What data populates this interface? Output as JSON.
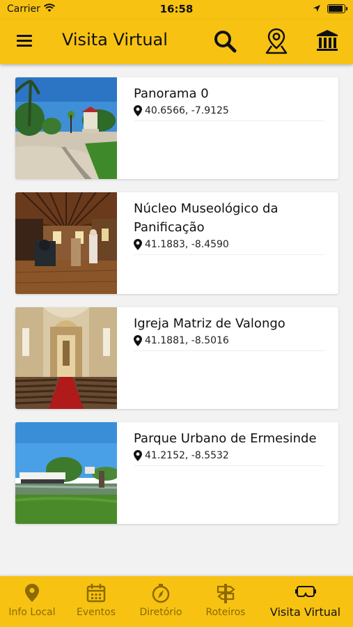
{
  "status": {
    "carrier": "Carrier",
    "time": "16:58"
  },
  "header": {
    "title": "Visita Virtual"
  },
  "items": [
    {
      "title": "Panorama 0",
      "coords": "40.6566, -7.9125"
    },
    {
      "title": "Núcleo Museológico da Panificação",
      "coords": "41.1883, -8.4590"
    },
    {
      "title": "Igreja Matriz de Valongo",
      "coords": "41.1881, -8.5016"
    },
    {
      "title": "Parque Urbano de Ermesinde",
      "coords": "41.2152, -8.5532"
    }
  ],
  "nav": [
    {
      "label": "Info Local",
      "icon": "map-pin-icon"
    },
    {
      "label": "Eventos",
      "icon": "calendar-icon"
    },
    {
      "label": "Diretório",
      "icon": "compass-icon"
    },
    {
      "label": "Roteiros",
      "icon": "signpost-icon"
    },
    {
      "label": "Visita Virtual",
      "icon": "vr-headset-icon",
      "active": true
    }
  ],
  "colors": {
    "accent": "#f7c212",
    "nav_inactive": "#8c6a00"
  }
}
